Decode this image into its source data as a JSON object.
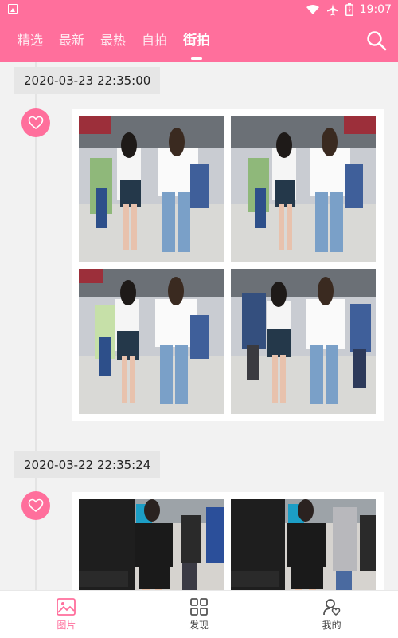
{
  "status_bar": {
    "time": "19:07"
  },
  "tabs": [
    {
      "label": "精选"
    },
    {
      "label": "最新"
    },
    {
      "label": "最热"
    },
    {
      "label": "自拍"
    },
    {
      "label": "街拍"
    }
  ],
  "active_tab": "街拍",
  "posts": [
    {
      "date": "2020-03-23 22:35:00"
    },
    {
      "date": "2020-03-22 22:35:24"
    }
  ],
  "bottom_nav": [
    {
      "label": "图片",
      "icon": "image-icon"
    },
    {
      "label": "发现",
      "icon": "grid-icon"
    },
    {
      "label": "我的",
      "icon": "user-heart-icon"
    }
  ],
  "colors": {
    "accent": "#ff6f9c",
    "background": "#f2f2f2",
    "date_chip": "#e6e6e6"
  }
}
